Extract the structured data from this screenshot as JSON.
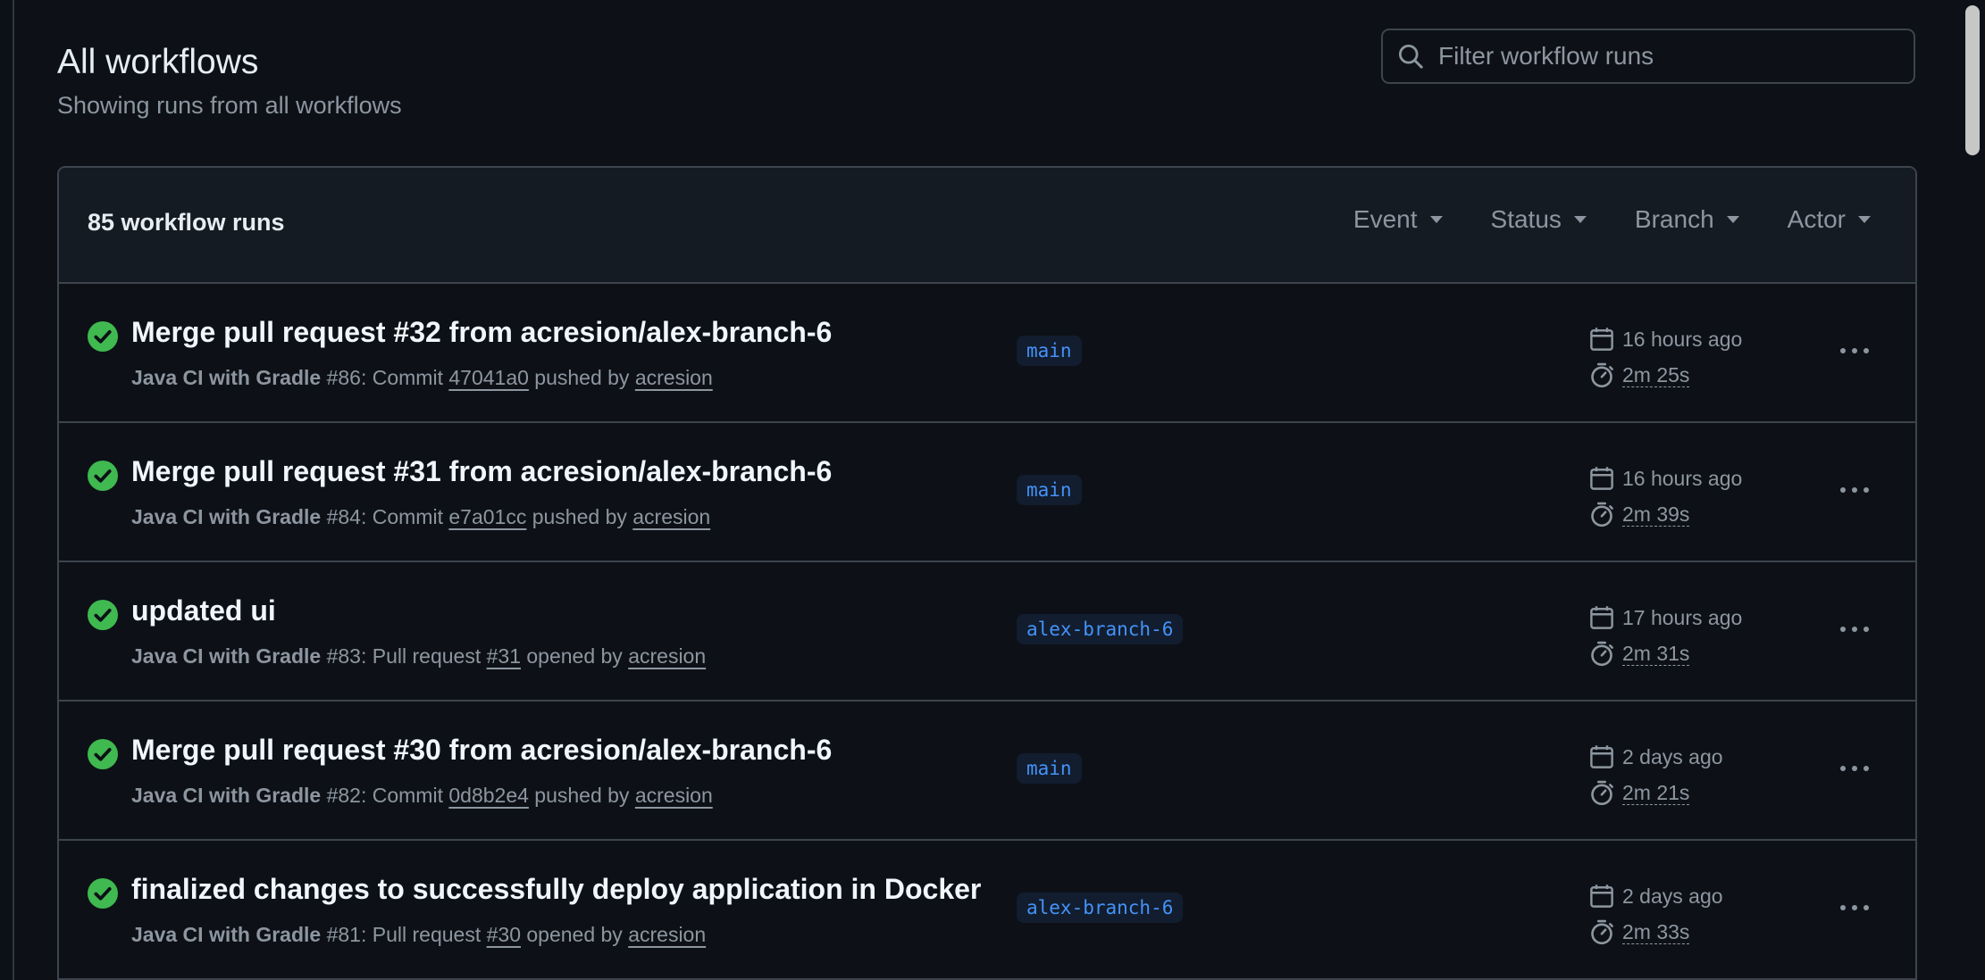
{
  "header": {
    "title": "All workflows",
    "subtitle": "Showing runs from all workflows"
  },
  "search": {
    "placeholder": "Filter workflow runs",
    "value": ""
  },
  "runs_header": {
    "count_label": "85 workflow runs",
    "filters": [
      "Event",
      "Status",
      "Branch",
      "Actor"
    ]
  },
  "runs": [
    {
      "title": "Merge pull request #32 from acresion/alex-branch-6",
      "workflow": "Java CI with Gradle",
      "run_number": "#86",
      "trigger_prefix": ": Commit ",
      "trigger_ref": "47041a0",
      "trigger_verb": " pushed by ",
      "actor": "acresion",
      "branch": "main",
      "when": "16 hours ago",
      "duration": "2m 25s",
      "status": "success"
    },
    {
      "title": "Merge pull request #31 from acresion/alex-branch-6",
      "workflow": "Java CI with Gradle",
      "run_number": "#84",
      "trigger_prefix": ": Commit ",
      "trigger_ref": "e7a01cc",
      "trigger_verb": " pushed by ",
      "actor": "acresion",
      "branch": "main",
      "when": "16 hours ago",
      "duration": "2m 39s",
      "status": "success"
    },
    {
      "title": "updated ui",
      "workflow": "Java CI with Gradle",
      "run_number": "#83",
      "trigger_prefix": ": Pull request ",
      "trigger_ref": "#31",
      "trigger_verb": " opened by ",
      "actor": "acresion",
      "branch": "alex-branch-6",
      "when": "17 hours ago",
      "duration": "2m 31s",
      "status": "success"
    },
    {
      "title": "Merge pull request #30 from acresion/alex-branch-6",
      "workflow": "Java CI with Gradle",
      "run_number": "#82",
      "trigger_prefix": ": Commit ",
      "trigger_ref": "0d8b2e4",
      "trigger_verb": " pushed by ",
      "actor": "acresion",
      "branch": "main",
      "when": "2 days ago",
      "duration": "2m 21s",
      "status": "success"
    },
    {
      "title": "finalized changes to successfully deploy application in Docker",
      "workflow": "Java CI with Gradle",
      "run_number": "#81",
      "trigger_prefix": ": Pull request ",
      "trigger_ref": "#30",
      "trigger_verb": " opened by ",
      "actor": "acresion",
      "branch": "alex-branch-6",
      "when": "2 days ago",
      "duration": "2m 33s",
      "status": "success"
    }
  ],
  "colors": {
    "background": "#0d1117",
    "header_bg": "#151b23",
    "border": "#3d444d",
    "success": "#3fb950",
    "branch_text": "#4493f8",
    "muted": "#8d96a0"
  },
  "icons": {
    "search": "search-icon",
    "status": "check-circle-icon",
    "calendar": "calendar-icon",
    "stopwatch": "stopwatch-icon",
    "more": "kebab-horizontal-icon",
    "dropdown": "triangle-down-icon"
  }
}
